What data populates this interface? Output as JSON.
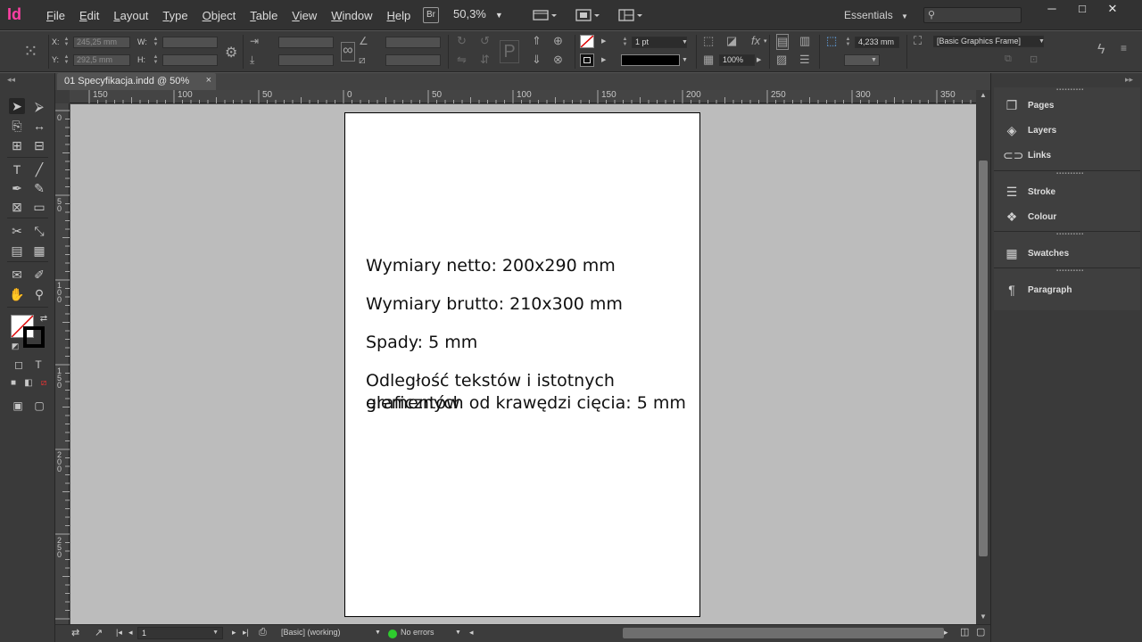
{
  "app": {
    "logo": "Id"
  },
  "menu": [
    "File",
    "Edit",
    "Layout",
    "Type",
    "Object",
    "Table",
    "View",
    "Window",
    "Help"
  ],
  "menubar": {
    "bridge_label": "Br",
    "zoom": "50,3%",
    "workspace": "Essentials",
    "search_placeholder": "",
    "window_buttons": {
      "minimize": "─",
      "maximize": "□",
      "close": "✕"
    }
  },
  "control": {
    "x_label": "X:",
    "x_value": "245,25 mm",
    "y_label": "Y:",
    "y_value": "292,5 mm",
    "w_label": "W:",
    "w_value": "",
    "h_label": "H:",
    "h_value": "",
    "stroke_weight": "1 pt",
    "opacity": "100%",
    "measure": "4,233 mm",
    "object_style": "[Basic Graphics Frame]"
  },
  "document": {
    "tab_title": "01 Specyfikacja.indd @ 50%",
    "close_glyph": "×",
    "hruler_labels": [
      "150",
      "100",
      "50",
      "0",
      "50",
      "100",
      "150",
      "200",
      "250",
      "300",
      "350"
    ],
    "vruler_labels": [
      "0",
      "5 0",
      "1 0 0",
      "1 5 0",
      "2 0 0",
      "2 5 0"
    ],
    "page_lines": [
      "Wymiary netto: 200x290 mm",
      "Wymiary brutto: 210x300 mm",
      "Spady: 5 mm",
      "Odległość tekstów i istotnych elementów",
      "graficznych od krawędzi cięcia: 5 mm"
    ]
  },
  "status": {
    "page_number": "1",
    "style": "[Basic] (working)",
    "preflight": "No errors",
    "preflight_color": "#2ecc2e"
  },
  "panels": [
    {
      "label": "Pages",
      "icon": "pages-icon"
    },
    {
      "label": "Layers",
      "icon": "layers-icon"
    },
    {
      "label": "Links",
      "icon": "links-icon"
    },
    {
      "label": "Stroke",
      "icon": "stroke-icon"
    },
    {
      "label": "Colour",
      "icon": "colour-icon"
    },
    {
      "label": "Swatches",
      "icon": "swatches-icon"
    },
    {
      "label": "Paragraph",
      "icon": "paragraph-icon"
    }
  ],
  "colors": {
    "accent": "#ff3fa4",
    "pasteboard": "#bcbcbc",
    "chrome": "#3a3a3a"
  }
}
